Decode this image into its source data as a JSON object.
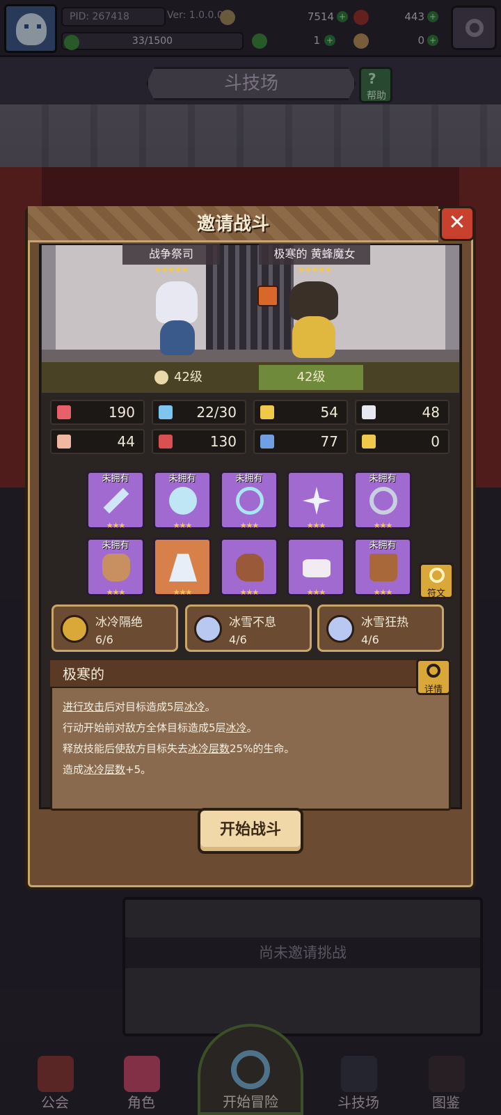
{
  "topbar": {
    "pid": "PID: 267418",
    "version": "Ver: 1.0.0.0",
    "gold": "7514",
    "gems": "443",
    "clover": "1",
    "key": "0",
    "exp": "33/1500"
  },
  "arena": {
    "title": "斗技场",
    "help_label": "帮助"
  },
  "modal": {
    "title": "邀请战斗",
    "close": "✕",
    "player_name": "战争祭司",
    "player_stars": "★★★★★",
    "opponent_name": "极寒的 黄蜂魔女",
    "opponent_stars": "★★★★★",
    "player_level": "42级",
    "opponent_level": "42级",
    "stats": [
      {
        "icon": "heart-icon",
        "value": "190",
        "color": "#e8606a"
      },
      {
        "icon": "mana-drop-icon",
        "value": "22/30",
        "color": "#7ec6f0"
      },
      {
        "icon": "shield-icon",
        "value": "54",
        "color": "#f0c84a"
      },
      {
        "icon": "wing-icon",
        "value": "48",
        "color": "#e8e8f0"
      },
      {
        "icon": "fist-icon",
        "value": "44",
        "color": "#f0b8a0"
      },
      {
        "icon": "book-icon",
        "value": "130",
        "color": "#d85050"
      },
      {
        "icon": "scroll-icon",
        "value": "77",
        "color": "#70a0e0"
      },
      {
        "icon": "horseshoe-icon",
        "value": "0",
        "color": "#f0c84a"
      }
    ],
    "equipment": [
      {
        "name": "staff-icon",
        "owned": "未拥有",
        "stars": "★★★",
        "color": "purple"
      },
      {
        "name": "crystal-ball-icon",
        "owned": "未拥有",
        "stars": "★★★",
        "color": "purple"
      },
      {
        "name": "necklace-icon",
        "owned": "未拥有",
        "stars": "★★★",
        "color": "purple"
      },
      {
        "name": "snowflake-icon",
        "owned": "",
        "stars": "★★★",
        "color": "purple"
      },
      {
        "name": "ring-icon",
        "owned": "未拥有",
        "stars": "★★★",
        "color": "purple"
      },
      {
        "name": "bull-helmet-icon",
        "owned": "未拥有",
        "stars": "★★★",
        "color": "purple"
      },
      {
        "name": "cape-icon",
        "owned": "",
        "stars": "★★★",
        "color": "orange"
      },
      {
        "name": "glove-icon",
        "owned": "",
        "stars": "★★★",
        "color": "purple"
      },
      {
        "name": "belt-icon",
        "owned": "",
        "stars": "★★★",
        "color": "purple"
      },
      {
        "name": "boots-icon",
        "owned": "未拥有",
        "stars": "★★★",
        "color": "purple"
      }
    ],
    "rune_label": "符文",
    "sets": [
      {
        "name": "冰冷隔绝",
        "count": "6/6",
        "color": "#d9a838"
      },
      {
        "name": "冰雪不息",
        "count": "4/6",
        "color": "#b8c8f0"
      },
      {
        "name": "冰雪狂热",
        "count": "4/6",
        "color": "#b8c8f0"
      }
    ],
    "desc_title": "极寒的",
    "detail_label": "详情",
    "desc_lines": [
      {
        "pre": "",
        "u": "进行攻击",
        "mid": "后对目标造成5层",
        "u2": "冰冷",
        "post": "。"
      },
      {
        "pre": "行动开始前对敌方全体目标造成5层",
        "u": "冰冷",
        "mid": "。",
        "u2": "",
        "post": ""
      },
      {
        "pre": "释放技能后使敌方目标失去",
        "u": "冰冷层数",
        "mid": "25%的生命。",
        "u2": "",
        "post": ""
      },
      {
        "pre": "造成",
        "u": "冰冷层数",
        "mid": "+5。",
        "u2": "",
        "post": ""
      }
    ],
    "start_button": "开始战斗"
  },
  "no_challenge": "尚未邀请挑战",
  "nav": {
    "guild": "公会",
    "character": "角色",
    "adventure": "开始冒险",
    "arena": "斗技场",
    "codex": "图鉴"
  }
}
